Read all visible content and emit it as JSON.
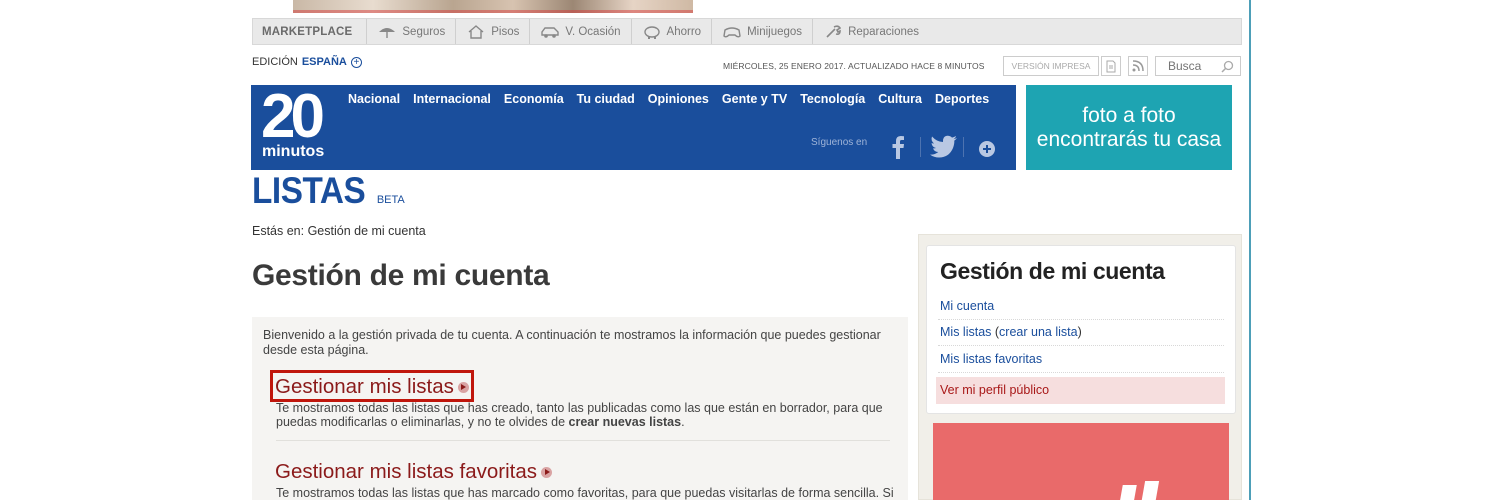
{
  "marketplace": {
    "brand": "MARKETPLACE",
    "items": [
      {
        "label": "Seguros",
        "icon": "umbrella-icon"
      },
      {
        "label": "Pisos",
        "icon": "house-icon"
      },
      {
        "label": "V. Ocasión",
        "icon": "car-icon"
      },
      {
        "label": "Ahorro",
        "icon": "piggy-bank-icon"
      },
      {
        "label": "Minijuegos",
        "icon": "gamepad-icon"
      },
      {
        "label": "Reparaciones",
        "icon": "wrench-icon"
      }
    ]
  },
  "edition": {
    "prefix": "EDICIÓN",
    "country": "ESPAÑA"
  },
  "dateline": "MIÉRCOLES, 25 ENERO 2017. ACTUALIZADO HACE 8 MINUTOS",
  "print_version": "VERSIÓN IMPRESA",
  "search": {
    "placeholder": "Busca"
  },
  "logo": {
    "number": "20",
    "word": "minutos"
  },
  "nav": [
    "Nacional",
    "Internacional",
    "Economía",
    "Tu ciudad",
    "Opiniones",
    "Gente y TV",
    "Tecnología",
    "Cultura",
    "Deportes"
  ],
  "follow_label": "Síguenos en",
  "header_ad": {
    "line1": "foto a foto",
    "line2": "encontrarás tu casa"
  },
  "section": {
    "title": "LISTAS",
    "badge": "BETA"
  },
  "breadcrumb": "Estás en: Gestión de mi cuenta",
  "page_title": "Gestión de mi cuenta",
  "intro": "Bienvenido a la gestión privada de tu cuenta. A continuación te mostramos la información que puedes gestionar desde esta página.",
  "blocks": [
    {
      "title": "Gestionar mis listas",
      "desc_pre": "Te mostramos todas las listas que has creado, tanto las publicadas como las que están en borrador, para que puedas modificarlas o eliminarlas, y no te olvides de ",
      "desc_bold": "crear nuevas listas",
      "desc_post": "."
    },
    {
      "title": "Gestionar mis listas favoritas",
      "desc": "Te mostramos todas las listas que has marcado como favoritas, para que puedas visitarlas de forma sencilla. Si te"
    }
  ],
  "sidebar": {
    "title": "Gestión de mi cuenta",
    "links": {
      "my_account": "Mi cuenta",
      "my_lists": "Mis listas",
      "open_paren": " (",
      "create_list": "crear una lista",
      "close_paren": ")",
      "favorites": "Mis listas favoritas",
      "public_profile": "Ver mi perfil público"
    }
  },
  "colors": {
    "brand_blue": "#1a4e9c",
    "link_red": "#8b1a1a",
    "highlight": "#c0160c",
    "ad_teal": "#1ea4b2"
  }
}
